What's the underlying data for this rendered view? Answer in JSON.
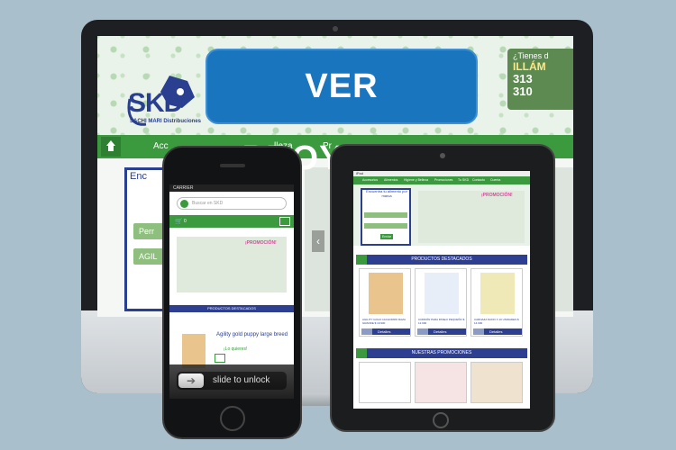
{
  "banner": {
    "label": "VER PROYECTO"
  },
  "desktop": {
    "logo": {
      "text": "SKD",
      "subtitle": "SACHI MARI Distribuciones"
    },
    "contact": {
      "question": "¿Tienes d",
      "call": "ILLÁM",
      "phone1": "313",
      "phone2": "310"
    },
    "nav": [
      "Acc",
      "lleza",
      "Pr"
    ],
    "search_title": "Enc",
    "pills": [
      "Perr",
      "AGIL"
    ],
    "slider_prev": "‹"
  },
  "tablet": {
    "status": "iPad",
    "nav": [
      "Accesorios",
      "Alimentos",
      "Higiene y Belleza",
      "Promociones",
      "Tu SKD",
      "Contacto",
      "Cuenta"
    ],
    "search_title": "Encuentra tu alimento por marca",
    "go_label": "Enviar",
    "promo_label": "¡PROMOCIÓN!",
    "featured_title": "PRODUCTOS DESTACADOS",
    "details_label": "Detalles",
    "products": [
      {
        "name": "AGILITY GOLD CACHORRO RAZA GRANDE $ 19.900"
      },
      {
        "name": "CORDÓN PARA PASEO PEQUEÑO $ 12.900"
      },
      {
        "name": "CARNAZA NUDO X 10 UNIDADES $ 14.900"
      }
    ],
    "promos_title": "NUESTRAS PROMOCIONES"
  },
  "phone": {
    "status": "CARRIER",
    "search_placeholder": "Buscar en SKD",
    "cart_count": "0",
    "promo_label": "¡PROMOCIÓN!",
    "featured_title": "PRODUCTOS DESTACADOS",
    "product_name": "Agility gold puppy large breed",
    "product_sub": "¡Lo quieres!",
    "unlock_text": "slide to unlock"
  },
  "colors": {
    "green": "#3a9a3d",
    "navy": "#2e3f92",
    "cta_blue": "#1a75bf",
    "background": "#a9bfcc"
  },
  "icons": [
    "home-icon",
    "cart-icon",
    "search-icon",
    "menu-icon",
    "star-icon",
    "arrow-right-icon"
  ]
}
